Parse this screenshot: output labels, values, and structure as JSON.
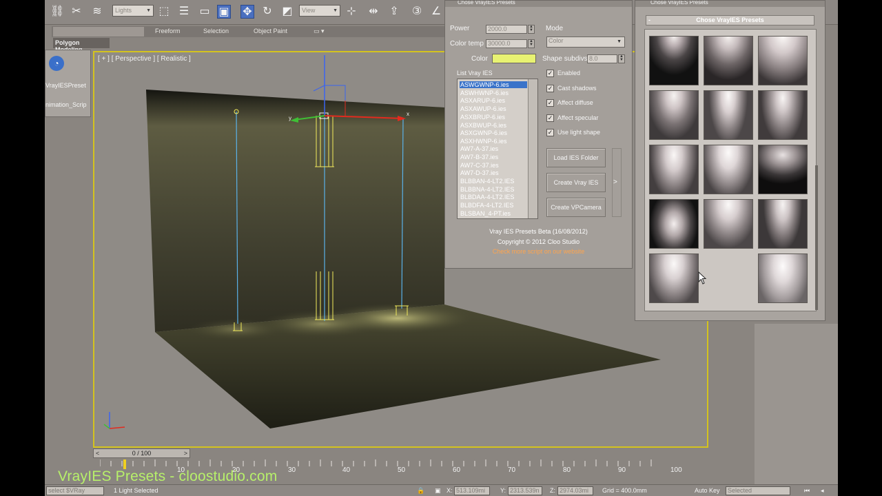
{
  "toolbar": {
    "lights_select": "Lights",
    "view_select": "View",
    "icons": [
      "select-link-icon",
      "unlink-icon",
      "bind-space-warp-icon",
      "select-object-icon",
      "select-by-name-icon",
      "rect-region-icon",
      "window-crossing-icon",
      "move-icon",
      "rotate-icon",
      "scale-icon",
      "mirror-icon",
      "align-icon",
      "layer-icon",
      "snap-3d-icon",
      "angle-snap-icon"
    ]
  },
  "ribbon": {
    "tabs": [
      "Freeform",
      "Selection",
      "Object Paint"
    ],
    "sub_label": "Polygon Modeling"
  },
  "left_panel": {
    "items": [
      "VrayIESPreset",
      "nimation_Scrip"
    ]
  },
  "viewport": {
    "label": "[ + ] [ Perspective ] [ Realistic ]",
    "accent": "#d4c31e"
  },
  "timeline": {
    "frame": "0 / 100",
    "prev": "<",
    "next": ">",
    "ticks": [
      "10",
      "20",
      "30",
      "40",
      "50",
      "60",
      "70",
      "80",
      "90",
      "100"
    ]
  },
  "watermark": "VrayIES Presets - cloostudio.com",
  "status": {
    "maxscript": "select $VRay",
    "selection": "1 Light Selected",
    "x_label": "X:",
    "x_value": "513.109mi",
    "y_label": "Y:",
    "y_value": "2313.539n",
    "z_label": "Z:",
    "z_value": "2974.03mi",
    "grid": "Grid = 400.0mm",
    "autokey": "Auto Key",
    "selected": "Selected"
  },
  "dialog": {
    "title": "Chose VrayIES Presets",
    "power_label": "Power",
    "power_value": "2000.0",
    "mode_label": "Mode",
    "mode_value": "Color",
    "colortemp_label": "Color temp",
    "colortemp_value": "30000.0",
    "color_label": "Color",
    "color_swatch": "#e8f272",
    "shape_label": "Shape subdivs",
    "shape_value": "8.0",
    "list_label": "List Vray IES",
    "list_items": [
      "ASWGWNP-6.ies",
      "ASWHWNP-6.ies",
      "ASXARUP-6.ies",
      "ASXAWUP-6.ies",
      "ASXBRUP-6.ies",
      "ASXBWUP-6.ies",
      "ASXGWNP-6.ies",
      "ASXHWNP-6.ies",
      "AW7-A-37.ies",
      "AW7-B-37.ies",
      "AW7-C-37.ies",
      "AW7-D-37.ies",
      "BLBBAN-4-LT2.IES",
      "BLBBNA-4-LT2.IES",
      "BLBDAA-4-LT2.IES",
      "BLBDFA-4-LT2.IES",
      "BLSBAN_4-PT.ies"
    ],
    "checks": [
      {
        "label": "Enabled",
        "checked": true
      },
      {
        "label": "Cast shadows",
        "checked": true
      },
      {
        "label": "Affect diffuse",
        "checked": true
      },
      {
        "label": "Affect specular",
        "checked": true
      },
      {
        "label": "Use light shape",
        "checked": true
      }
    ],
    "buttons": [
      "Load IES Folder",
      "Create Vray IES",
      "Create VPCamera"
    ],
    "expand": ">",
    "footer_version": "Vray IES Presets Beta (16/08/2012)",
    "footer_copyright": "Copyright © 2012 Cloo Studio",
    "footer_link": "Check more script on our website"
  },
  "presets": {
    "window_title": "Chose VrayIES Presets",
    "header": "Chose VrayIES Presets",
    "collapse": "-",
    "thumbnails": 14
  }
}
